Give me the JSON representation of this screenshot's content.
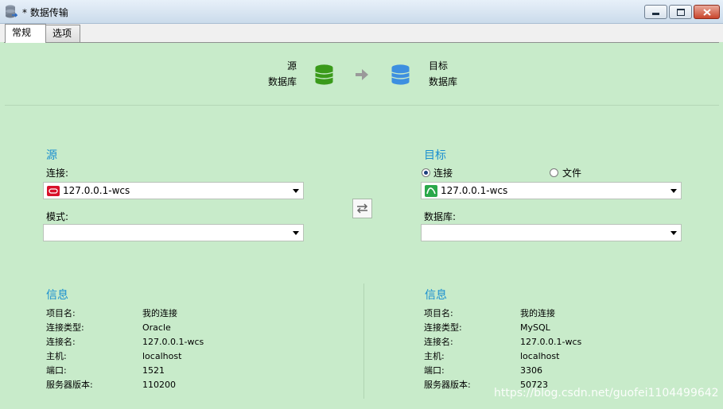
{
  "window": {
    "title": "* 数据传输"
  },
  "tabs": [
    {
      "label": "常规",
      "active": true
    },
    {
      "label": "选项",
      "active": false
    }
  ],
  "header": {
    "source_line1": "源",
    "source_line2": "数据库",
    "target_line1": "目标",
    "target_line2": "数据库",
    "source_icon_color": "#3a9a1a",
    "target_icon_color": "#3d8fe0"
  },
  "source": {
    "title": "源",
    "connection_label": "连接:",
    "connection_value": "127.0.0.1-wcs",
    "connection_icon": "oracle-icon",
    "schema_label": "模式:",
    "schema_value": ""
  },
  "target": {
    "title": "目标",
    "radio_connection": "连接",
    "radio_file": "文件",
    "selected_radio": "连接",
    "connection_value": "127.0.0.1-wcs",
    "connection_icon": "mysql-icon",
    "database_label": "数据库:",
    "database_value": ""
  },
  "source_info": {
    "title": "信息",
    "rows": [
      {
        "key": "项目名:",
        "value": "我的连接"
      },
      {
        "key": "连接类型:",
        "value": "Oracle"
      },
      {
        "key": "连接名:",
        "value": "127.0.0.1-wcs"
      },
      {
        "key": "主机:",
        "value": "localhost"
      },
      {
        "key": "端口:",
        "value": "1521"
      },
      {
        "key": "服务器版本:",
        "value": "110200"
      }
    ]
  },
  "target_info": {
    "title": "信息",
    "rows": [
      {
        "key": "项目名:",
        "value": "我的连接"
      },
      {
        "key": "连接类型:",
        "value": "MySQL"
      },
      {
        "key": "连接名:",
        "value": "127.0.0.1-wcs"
      },
      {
        "key": "主机:",
        "value": "localhost"
      },
      {
        "key": "端口:",
        "value": "3306"
      },
      {
        "key": "服务器版本:",
        "value": "50723"
      }
    ]
  },
  "watermark": "https://blog.csdn.net/guofei1104499642",
  "colors": {
    "background": "#c8ebca",
    "section_title": "#1a8fd0"
  }
}
